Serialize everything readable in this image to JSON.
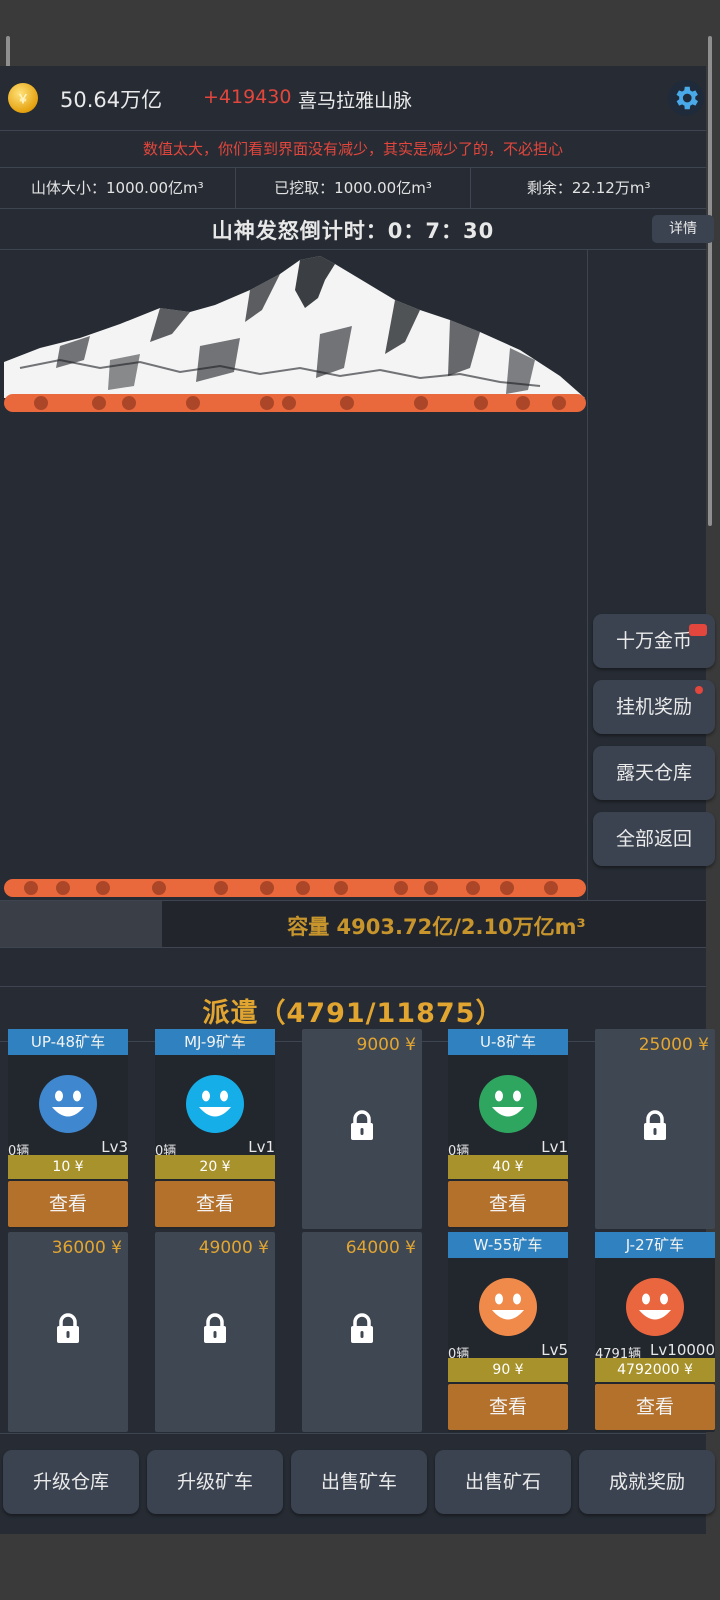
{
  "header": {
    "gold": "50.64万亿",
    "income": "+419430",
    "mountain_name": "喜马拉雅山脉",
    "coin_symbol": "￥"
  },
  "notice": "数值太大，你们看到界面没有减少，其实是减少了的，不必担心",
  "stats": [
    {
      "text": "山体大小：1000.00亿m³"
    },
    {
      "text": "已挖取：1000.00亿m³"
    },
    {
      "text": "剩余：22.12万m³"
    }
  ],
  "countdown": {
    "text": "山神发怒倒计时：0：7：30",
    "detail_label": "详情"
  },
  "side_buttons": [
    {
      "label": "十万金币",
      "badge": "video"
    },
    {
      "label": "挂机奖励",
      "badge": "dot"
    },
    {
      "label": "露天仓库",
      "badge": ""
    },
    {
      "label": "全部返回",
      "badge": ""
    }
  ],
  "capacity": {
    "text": "容量 4903.72亿/2.10万亿m³",
    "fill_fraction": 0.23
  },
  "dispatch": "派遣（4791/11875）",
  "cards": [
    {
      "type": "miner",
      "title": "UP-48矿车",
      "count": "0辆",
      "level": "Lv3",
      "cost": "10 ¥",
      "view": "查看",
      "color": "#3f87cf"
    },
    {
      "type": "miner",
      "title": "MJ-9矿车",
      "count": "0辆",
      "level": "Lv1",
      "cost": "20 ¥",
      "view": "查看",
      "color": "#16aee8"
    },
    {
      "type": "locked",
      "price": "9000 ¥"
    },
    {
      "type": "miner",
      "title": "U-8矿车",
      "count": "0辆",
      "level": "Lv1",
      "cost": "40 ¥",
      "view": "查看",
      "color": "#2fa660"
    },
    {
      "type": "locked",
      "price": "25000 ¥"
    },
    {
      "type": "locked",
      "price": "36000 ¥"
    },
    {
      "type": "locked",
      "price": "49000 ¥"
    },
    {
      "type": "locked",
      "price": "64000 ¥"
    },
    {
      "type": "miner",
      "title": "W-55矿车",
      "count": "0辆",
      "level": "Lv5",
      "cost": "90 ¥",
      "view": "查看",
      "color": "#ef8a4a"
    },
    {
      "type": "miner",
      "title": "J-27矿车",
      "count": "4791辆",
      "level": "Lv10000",
      "cost": "4792000 ¥",
      "view": "查看",
      "color": "#e9663f"
    }
  ],
  "toolbar": [
    {
      "label": "升级仓库"
    },
    {
      "label": "升级矿车"
    },
    {
      "label": "出售矿车"
    },
    {
      "label": "出售矿石"
    },
    {
      "label": "成就奖励"
    }
  ],
  "colors": {
    "accent_gold": "#e2a530",
    "alert_red": "#e2463c",
    "belt_orange": "#e9693d"
  }
}
